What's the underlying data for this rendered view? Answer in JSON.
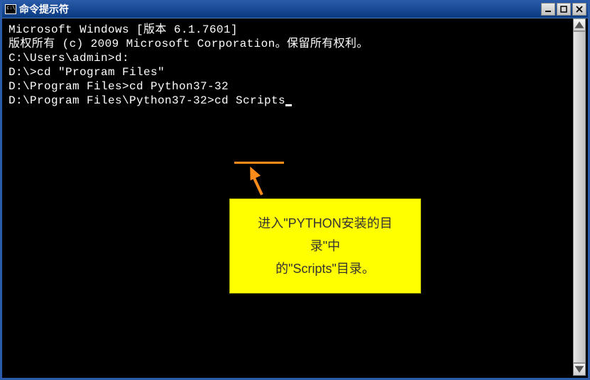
{
  "window": {
    "title": "命令提示符"
  },
  "terminal": {
    "line1": "Microsoft Windows [版本 6.1.7601]",
    "line2": "版权所有 (c) 2009 Microsoft Corporation。保留所有权利。",
    "line3": "",
    "line4": "C:\\Users\\admin>d:",
    "line5": "",
    "line6": "D:\\>cd \"Program Files\"",
    "line7": "",
    "line8": "D:\\Program Files>cd Python37-32",
    "line9": "",
    "line10": "D:\\Program Files\\Python37-32>cd Scripts"
  },
  "callout": {
    "line1": "进入\"PYTHON安装的目录\"中",
    "line2": "的\"Scripts\"目录。"
  }
}
